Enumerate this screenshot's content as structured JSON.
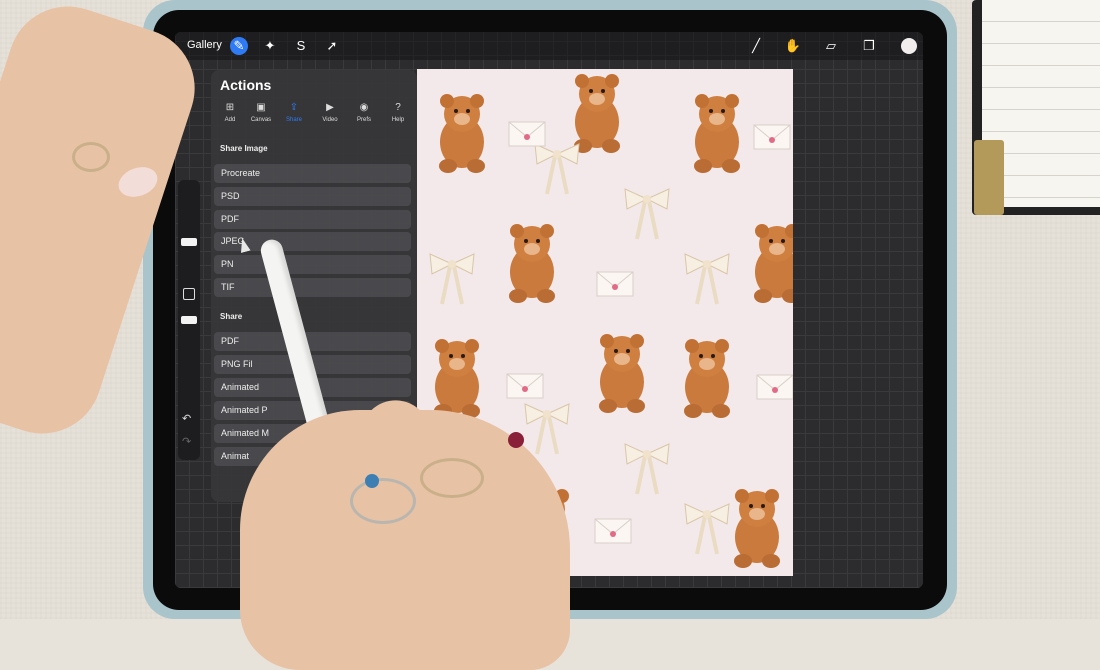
{
  "topbar": {
    "gallery_label": "Gallery",
    "icons": [
      "wrench-icon",
      "magic-wand-icon",
      "selection-icon",
      "transform-arrow-icon"
    ],
    "tool_icons": [
      "brush-icon",
      "smudge-icon",
      "eraser-icon",
      "layers-icon",
      "color-icon"
    ],
    "color": "#f3eeee",
    "accent": "#2f7bf5"
  },
  "actions": {
    "title": "Actions",
    "tabs": [
      {
        "label": "Add",
        "icon": "add-icon",
        "active": false
      },
      {
        "label": "Canvas",
        "icon": "canvas-icon",
        "active": false
      },
      {
        "label": "Share",
        "icon": "share-icon",
        "active": true
      },
      {
        "label": "Video",
        "icon": "video-icon",
        "active": false
      },
      {
        "label": "Prefs",
        "icon": "toggle-icon",
        "active": false
      },
      {
        "label": "Help",
        "icon": "help-icon",
        "active": false
      }
    ],
    "share_image_heading": "Share Image",
    "share_image_items": [
      "Procreate",
      "PSD",
      "PDF",
      "JPEG",
      "PN",
      "TIF"
    ],
    "share_layers_heading": "Share",
    "share_layers_items": [
      "PDF",
      "PNG Fil",
      "Animated",
      "Animated P",
      "Animated M",
      "Animat"
    ]
  }
}
